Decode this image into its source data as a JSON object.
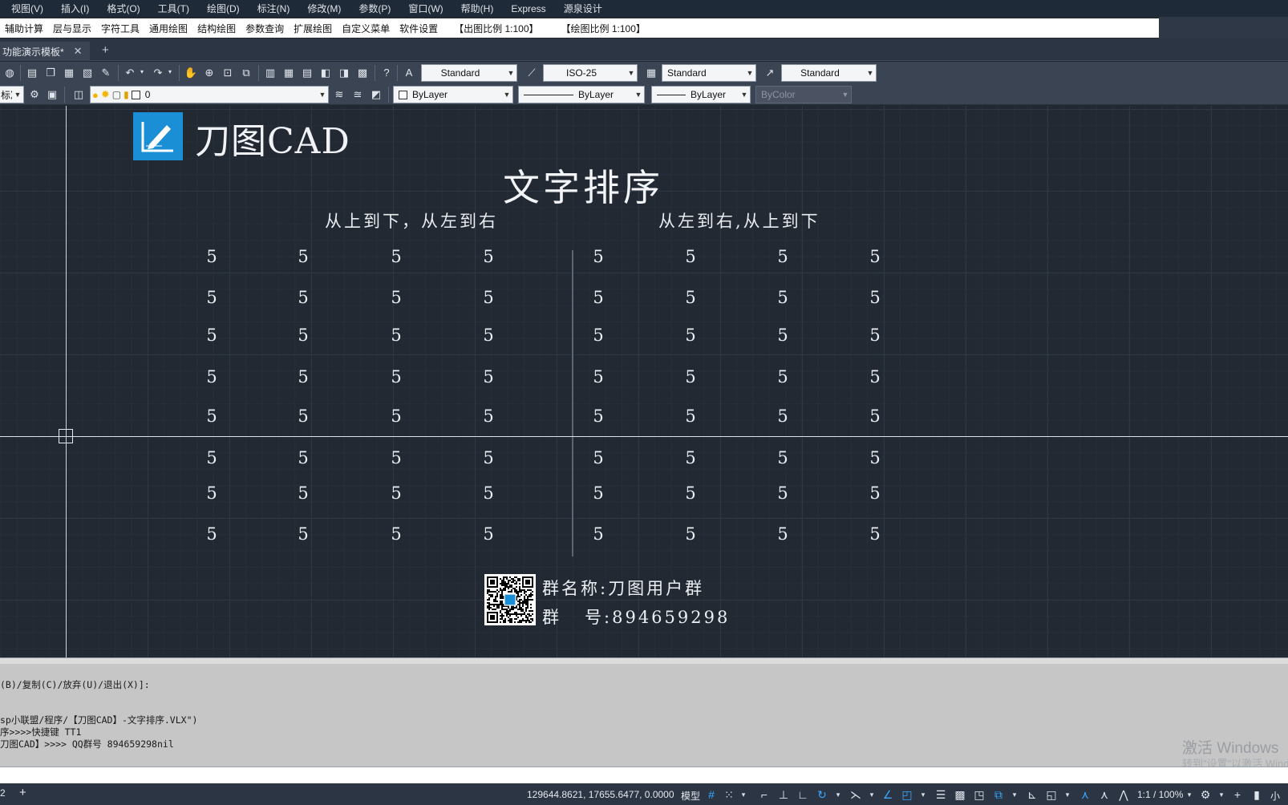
{
  "menu": {
    "items": [
      "视图(V)",
      "插入(I)",
      "格式(O)",
      "工具(T)",
      "绘图(D)",
      "标注(N)",
      "修改(M)",
      "参数(P)",
      "窗口(W)",
      "帮助(H)",
      "Express",
      "源泉设计"
    ]
  },
  "plugin_menu": {
    "items": [
      "辅助计算",
      "层与显示",
      "字符工具",
      "通用绘图",
      "结构绘图",
      "参数查询",
      "扩展绘图",
      "自定义菜单",
      "软件设置"
    ],
    "output_scale": "【出图比例 1:100】",
    "drawing_scale": "【绘图比例 1:100】"
  },
  "tabs": {
    "active": "功能演示模板*",
    "close_glyph": "✕",
    "add_glyph": "+"
  },
  "toolbar": {
    "text_style": "Standard",
    "dim_style": "ISO-25",
    "table_style": "Standard",
    "multileader_style": "Standard",
    "workspace_fragment": "标准",
    "layer": "0",
    "color": "ByLayer",
    "linetype": "ByLayer",
    "lineweight": "ByLayer",
    "plot_style": "ByColor"
  },
  "drawing": {
    "brand": "刀图CAD",
    "title": "文字排序",
    "left_heading": "从上到下，从左到右",
    "right_heading": "从左到右,从上到下",
    "rows": [
      [
        "5",
        "5",
        "5",
        "5",
        "5",
        "5",
        "5",
        "5"
      ],
      [
        "5",
        "5",
        "5",
        "5",
        "5",
        "5",
        "5",
        "5"
      ],
      [
        "5",
        "5",
        "5",
        "5",
        "5",
        "5",
        "5",
        "5"
      ],
      [
        "5",
        "5",
        "5",
        "5",
        "5",
        "5",
        "5",
        "5"
      ],
      [
        "5",
        "5",
        "5",
        "5",
        "5",
        "5",
        "5",
        "5"
      ],
      [
        "5",
        "5",
        "5",
        "5",
        "5",
        "5",
        "5",
        "5"
      ],
      [
        "5",
        "5",
        "5",
        "5",
        "5",
        "5",
        "5",
        "5"
      ],
      [
        "5",
        "5",
        "5",
        "5",
        "5",
        "5",
        "5",
        "5"
      ]
    ],
    "group_name": "群名称:刀图用户群",
    "group_number": "群   号:894659298"
  },
  "command": {
    "lines": [
      "(B)/复制(C)/放弃(U)/退出(X)]:",
      "sp小联盟/程序/【刀图CAD】-文字排序.VLX\")",
      "序>>>>快捷键 TT1",
      "刀图CAD】>>>> QQ群号 894659298nil"
    ],
    "watermark": "激活 Windows",
    "watermark_sub": "转到\"设置\"以激活 Windows"
  },
  "status": {
    "layout_fragment": "2",
    "add_glyph": "+",
    "coords": "129644.8621, 17655.6477, 0.0000",
    "model": "模型",
    "annotation_scale": "1:1 / 100%",
    "user_fragment": "小"
  },
  "colors": {
    "canvas": "#222933",
    "ui_dark": "#3b4452",
    "logo": "#1a8fd6",
    "active_toggle": "#3aa7ff",
    "command_bg": "#c6c6c6"
  }
}
